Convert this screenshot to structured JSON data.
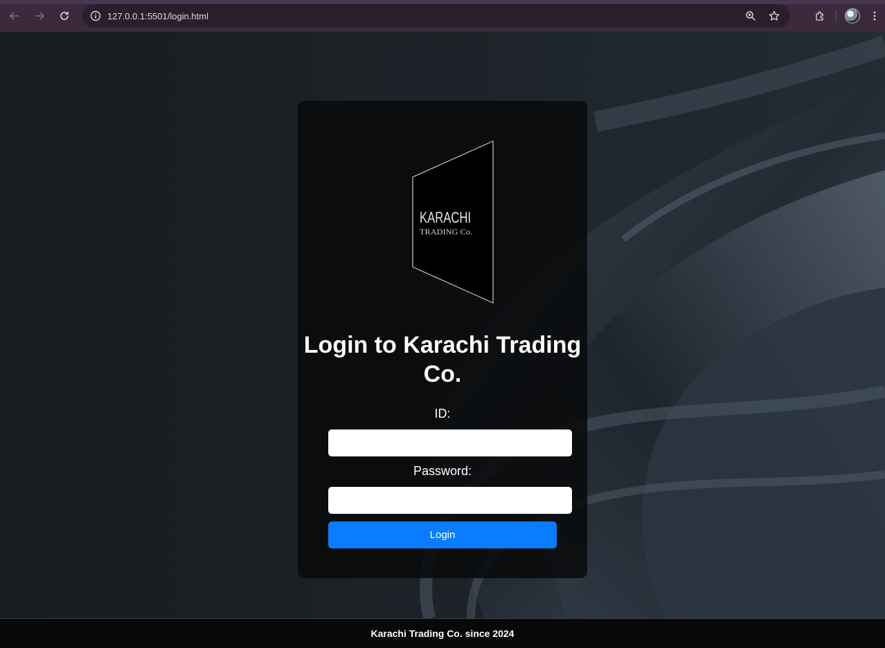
{
  "browser": {
    "url": "127.0.0.1:5501/login.html",
    "icons": [
      "back-icon",
      "forward-icon",
      "reload-icon",
      "site-info-icon",
      "zoom-icon",
      "bookmark-star-icon",
      "extensions-icon",
      "profile-avatar",
      "menu-icon"
    ]
  },
  "logo": {
    "line1": "KARACHI",
    "line2": "TRADING Co."
  },
  "login": {
    "title": "Login to Karachi Trading Co.",
    "id_label": "ID:",
    "id_value": "",
    "password_label": "Password:",
    "password_value": "",
    "button_label": "Login"
  },
  "footer": {
    "text": "Karachi Trading Co. since 2024"
  },
  "colors": {
    "accent": "#0a7cff",
    "card_bg": "#08090b",
    "chrome_bg": "#3a2a3c",
    "footer_bg": "#070809"
  }
}
